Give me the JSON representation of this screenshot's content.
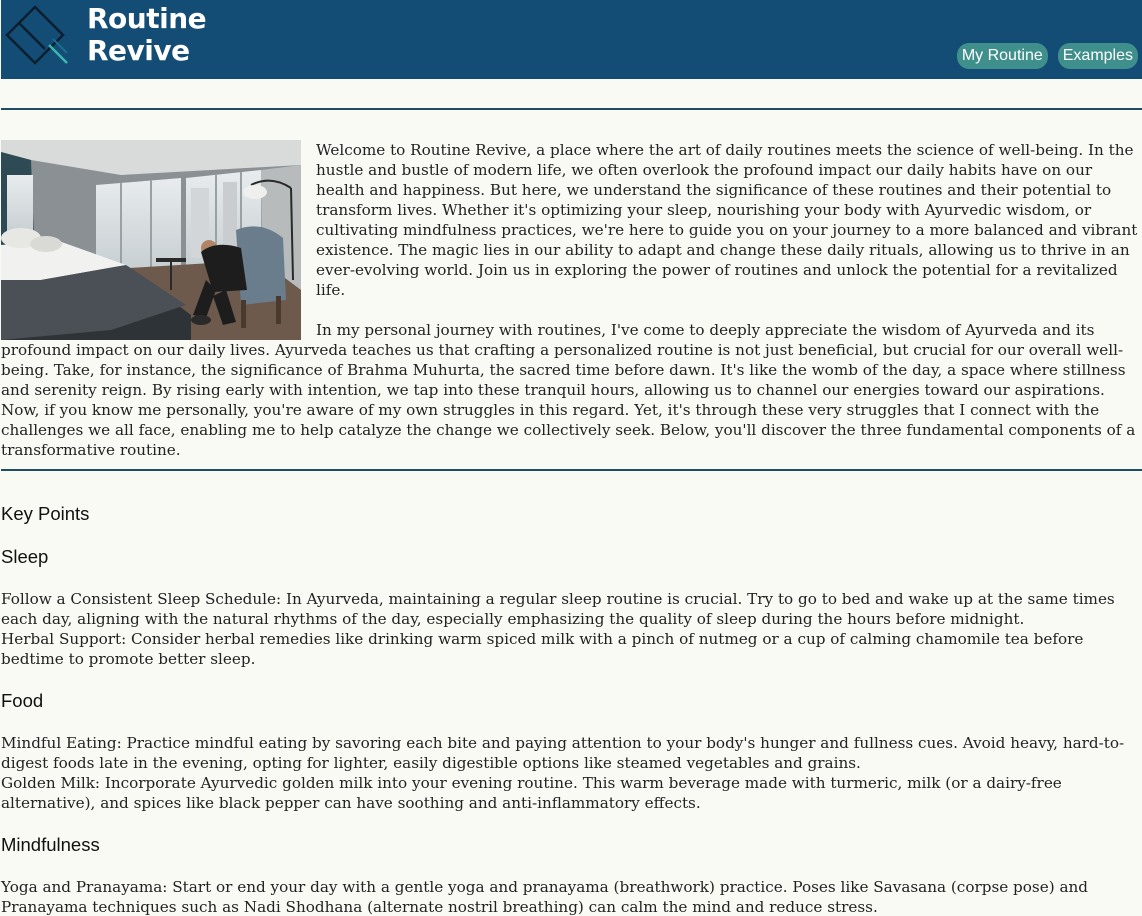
{
  "header": {
    "title_line1": "Routine",
    "title_line2": "Revive",
    "logo_icon": "diamond-logo-icon",
    "colors": {
      "bar": "#134c74",
      "button": "#3f8f8c"
    }
  },
  "nav": {
    "items": [
      {
        "label": "My Routine"
      },
      {
        "label": "Examples"
      }
    ]
  },
  "intro": {
    "paragraphs": [
      "Welcome to Routine Revive, a place where the art of daily routines meets the science of well-being. In the hustle and bustle of modern life, we often overlook the profound impact our daily habits have on our health and happiness. But here, we understand the significance of these routines and their potential to transform lives. Whether it's optimizing your sleep, nourishing your body with Ayurvedic wisdom, or cultivating mindfulness practices, we're here to guide you on your journey to a more balanced and vibrant existence. The magic lies in our ability to adapt and change these daily rituals, allowing us to thrive in an ever-evolving world. Join us in exploring the power of routines and unlock the potential for a revitalized life.",
      "In my personal journey with routines, I've come to deeply appreciate the wisdom of Ayurveda and its profound impact on our daily lives. Ayurveda teaches us that crafting a personalized routine is not just beneficial, but crucial for our overall well-being. Take, for instance, the significance of Brahma Muhurta, the sacred time before dawn. It's like the womb of the day, a space where stillness and serenity reign. By rising early with intention, we tap into these tranquil hours, allowing us to channel our energies toward our aspirations. Now, if you know me personally, you're aware of my own struggles in this regard. Yet, it's through these very struggles that I connect with the challenges we all face, enabling me to help catalyze the change we collectively seek. Below, you'll discover the three fundamental components of a transformative routine."
    ]
  },
  "key_points": {
    "title": "Key Points",
    "sections": [
      {
        "heading": "Sleep",
        "items": [
          "Follow a Consistent Sleep Schedule: In Ayurveda, maintaining a regular sleep routine is crucial. Try to go to bed and wake up at the same times each day, aligning with the natural rhythms of the day, especially emphasizing the quality of sleep during the hours before midnight.",
          "Herbal Support: Consider herbal remedies like drinking warm spiced milk with a pinch of nutmeg or a cup of calming chamomile tea before bedtime to promote better sleep."
        ]
      },
      {
        "heading": "Food",
        "items": [
          "Mindful Eating: Practice mindful eating by savoring each bite and paying attention to your body's hunger and fullness cues. Avoid heavy, hard-to-digest foods late in the evening, opting for lighter, easily digestible options like steamed vegetables and grains.",
          "Golden Milk: Incorporate Ayurvedic golden milk into your evening routine. This warm beverage made with turmeric, milk (or a dairy-free alternative), and spices like black pepper can have soothing and anti-inflammatory effects."
        ]
      },
      {
        "heading": "Mindfulness",
        "items": [
          "Yoga and Pranayama: Start or end your day with a gentle yoga and pranayama (breathwork) practice. Poses like Savasana (corpse pose) and Pranayama techniques such as Nadi Shodhana (alternate nostril breathing) can calm the mind and reduce stress."
        ]
      }
    ]
  }
}
